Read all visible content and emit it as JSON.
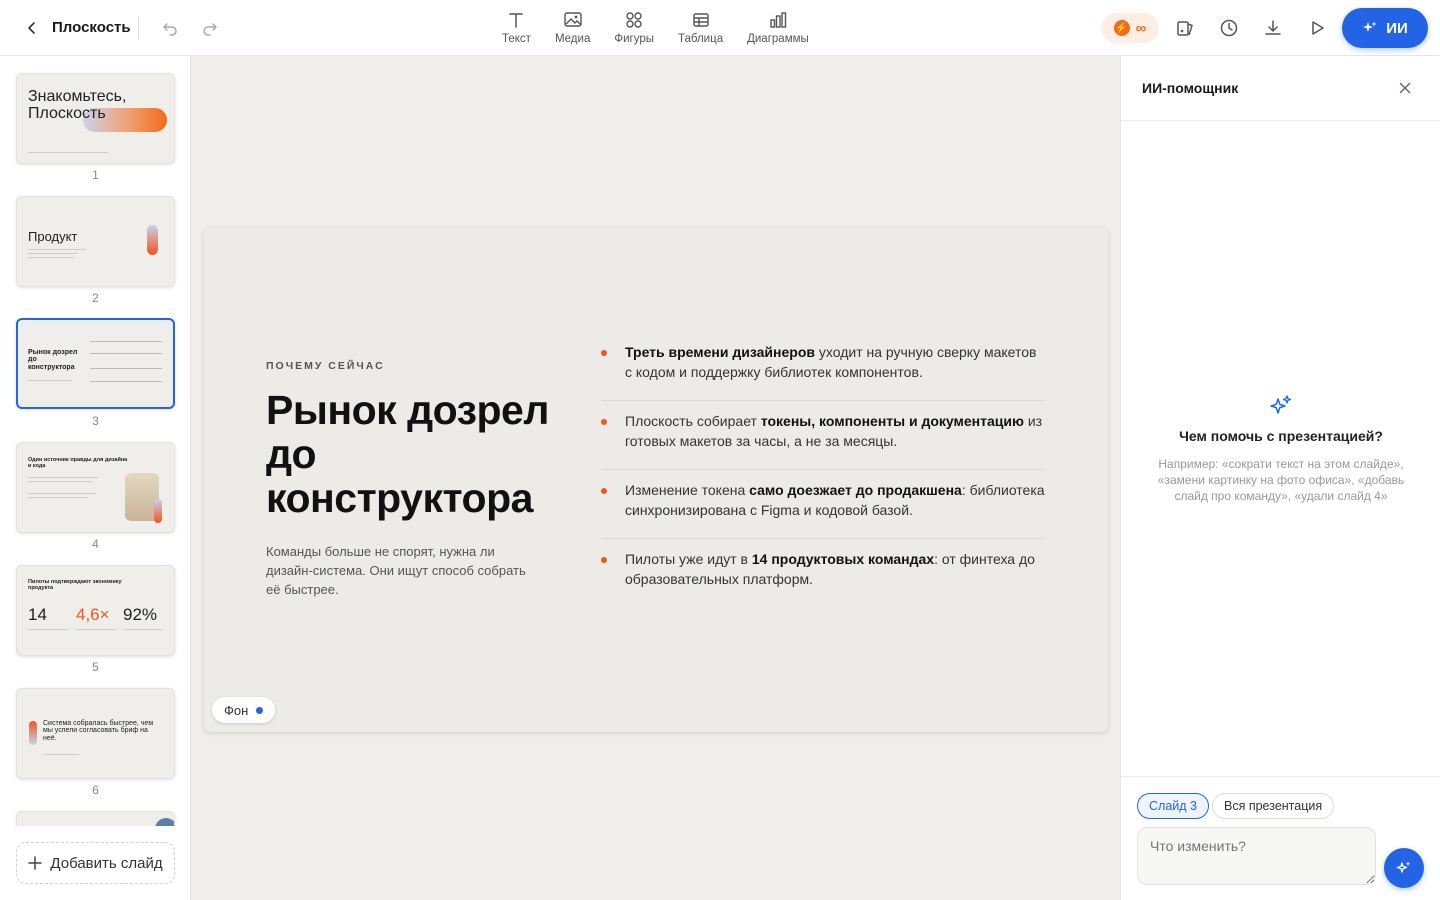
{
  "header": {
    "title": "Плоскость",
    "tools": [
      {
        "label": "Текст",
        "icon": "text-icon"
      },
      {
        "label": "Медиа",
        "icon": "image-icon"
      },
      {
        "label": "Фигуры",
        "icon": "shapes-icon"
      },
      {
        "label": "Таблица",
        "icon": "table-icon"
      },
      {
        "label": "Диаграммы",
        "icon": "chart-icon"
      }
    ],
    "credits": "∞",
    "ai_button": "ИИ"
  },
  "slides_panel": {
    "numbers": [
      "1",
      "2",
      "3",
      "4",
      "5",
      "6"
    ],
    "thumb1_title": "Знакомьтесь, Плоскость",
    "thumb2_title": "Продукт",
    "thumb3_title": "Рынок дозрел до конструктора",
    "thumb4_title": "Один источник правды для дизайна и кода",
    "thumb5_title": "Пилоты подтверждают экономику продукта",
    "thumb5_stats": [
      "14",
      "4,6×",
      "92%"
    ],
    "thumb6_title": "Система собралась быстрее, чем мы успели согласовать бриф на неё.",
    "add_slide": "Добавить слайд",
    "active_index": 3
  },
  "slide": {
    "eyebrow": "ПОЧЕМУ СЕЙЧАС",
    "headline": "Рынок дозрел до конструктора",
    "lead": "Команды больше не спорят, нужна ли дизайн-система. Они ищут способ собрать её быстрее.",
    "bullets": [
      {
        "bold": "Треть времени дизайнеров",
        "rest": " уходит на ручную сверку макетов с кодом и поддержку библиотек компонентов."
      },
      {
        "pre": "Плоскость собирает ",
        "bold": "токены, компоненты и документацию",
        "rest": " из готовых макетов за часы, а не за месяцы."
      },
      {
        "pre": "Изменение токена ",
        "bold": "само доезжает до продакшена",
        "rest": ": библиотека синхронизирована с Figma и кодовой базой."
      },
      {
        "pre": "Пилоты уже идут в ",
        "bold": "14 продуктовых командах",
        "rest": ": от финтеха до образовательных платформ."
      }
    ],
    "background_chip": "Фон"
  },
  "assistant": {
    "title": "ИИ-помощник",
    "empty_question": "Чем помочь с презентацией?",
    "empty_hint": "Например: «сократи текст на этом слайде», «замени картинку на фото офиса», «добавь слайд про команду», «удали слайд 4»",
    "scope_active": "Слайд 3",
    "scope_other": "Вся презентация",
    "input_placeholder": "Что изменить?"
  },
  "colors": {
    "accent": "#2264e5",
    "orange": "#f2551b"
  }
}
